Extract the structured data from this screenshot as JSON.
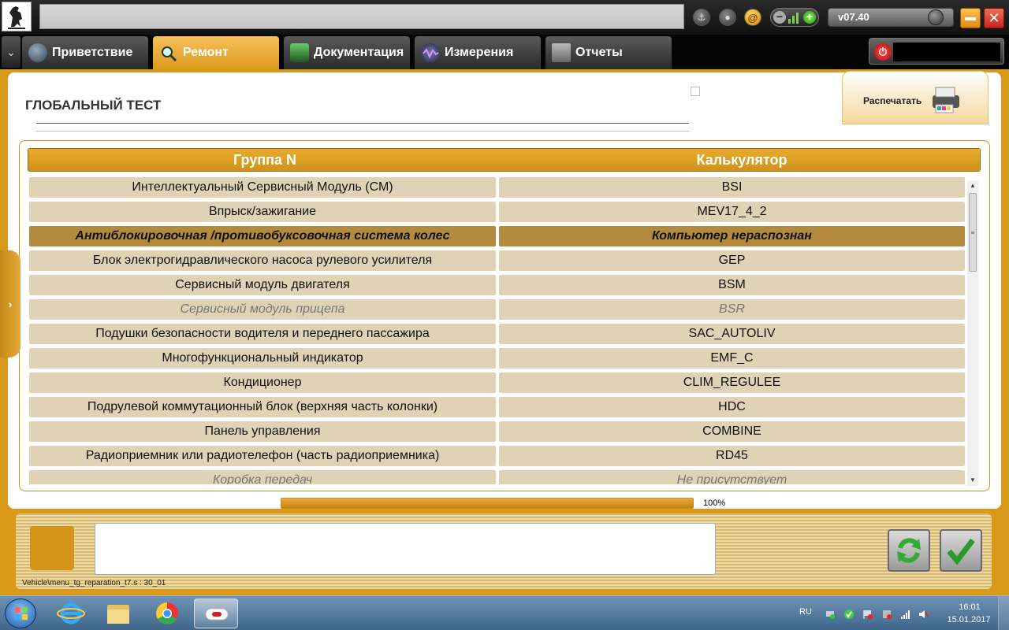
{
  "app": {
    "version": "v07.40"
  },
  "tabs": [
    {
      "label": "Приветствие"
    },
    {
      "label": "Ремонт"
    },
    {
      "label": "Документация"
    },
    {
      "label": "Измерения"
    },
    {
      "label": "Отчеты"
    }
  ],
  "page": {
    "title": "ГЛОБАЛЬНЫЙ ТЕСТ",
    "print_label": "Распечатать"
  },
  "table": {
    "col_group": "Группа N",
    "col_calc": "Калькулятор",
    "rows": [
      {
        "group": "Интеллектуальный Сервисный Модуль (СМ)",
        "calc": "BSI",
        "state": "normal"
      },
      {
        "group": "Впрыск/зажигание",
        "calc": "MEV17_4_2",
        "state": "normal"
      },
      {
        "group": "Антиблокировочная /противобуксовочная система колес",
        "calc": "Компьютер нераспознан",
        "state": "highlight"
      },
      {
        "group": "Блок электрогидравлического насоса рулевого усилителя",
        "calc": "GEP",
        "state": "normal"
      },
      {
        "group": "Сервисный модуль двигателя",
        "calc": "BSM",
        "state": "normal"
      },
      {
        "group": "Сервисный модуль прицепа",
        "calc": "BSR",
        "state": "disabled"
      },
      {
        "group": "Подушки безопасности водителя и переднего пассажира",
        "calc": "SAC_AUTOLIV",
        "state": "normal"
      },
      {
        "group": "Многофункциональный индикатор",
        "calc": "EMF_C",
        "state": "normal"
      },
      {
        "group": "Кондиционер",
        "calc": "CLIM_REGULEE",
        "state": "normal"
      },
      {
        "group": "Подрулевой коммутационный блок (верхняя часть колонки)",
        "calc": "HDC",
        "state": "normal"
      },
      {
        "group": "Панель управления",
        "calc": "COMBINE",
        "state": "normal"
      },
      {
        "group": "Радиоприемник или радиотелефон (часть радиоприемника)",
        "calc": "RD45",
        "state": "normal"
      },
      {
        "group": "Коробка передач",
        "calc": "Не присутствует",
        "state": "disabled"
      }
    ]
  },
  "progress": {
    "value": 1.0,
    "label": "100%"
  },
  "footer": {
    "path": "Vehicle\\menu_tg_reparation_t7.s : 30_01"
  },
  "taskbar": {
    "lang": "RU",
    "time": "16:01",
    "date": "15.01.2017"
  },
  "colors": {
    "accent": "#d99a1b",
    "row_bg": "#e0d2b4",
    "highlight_row": "#b48a3e"
  }
}
